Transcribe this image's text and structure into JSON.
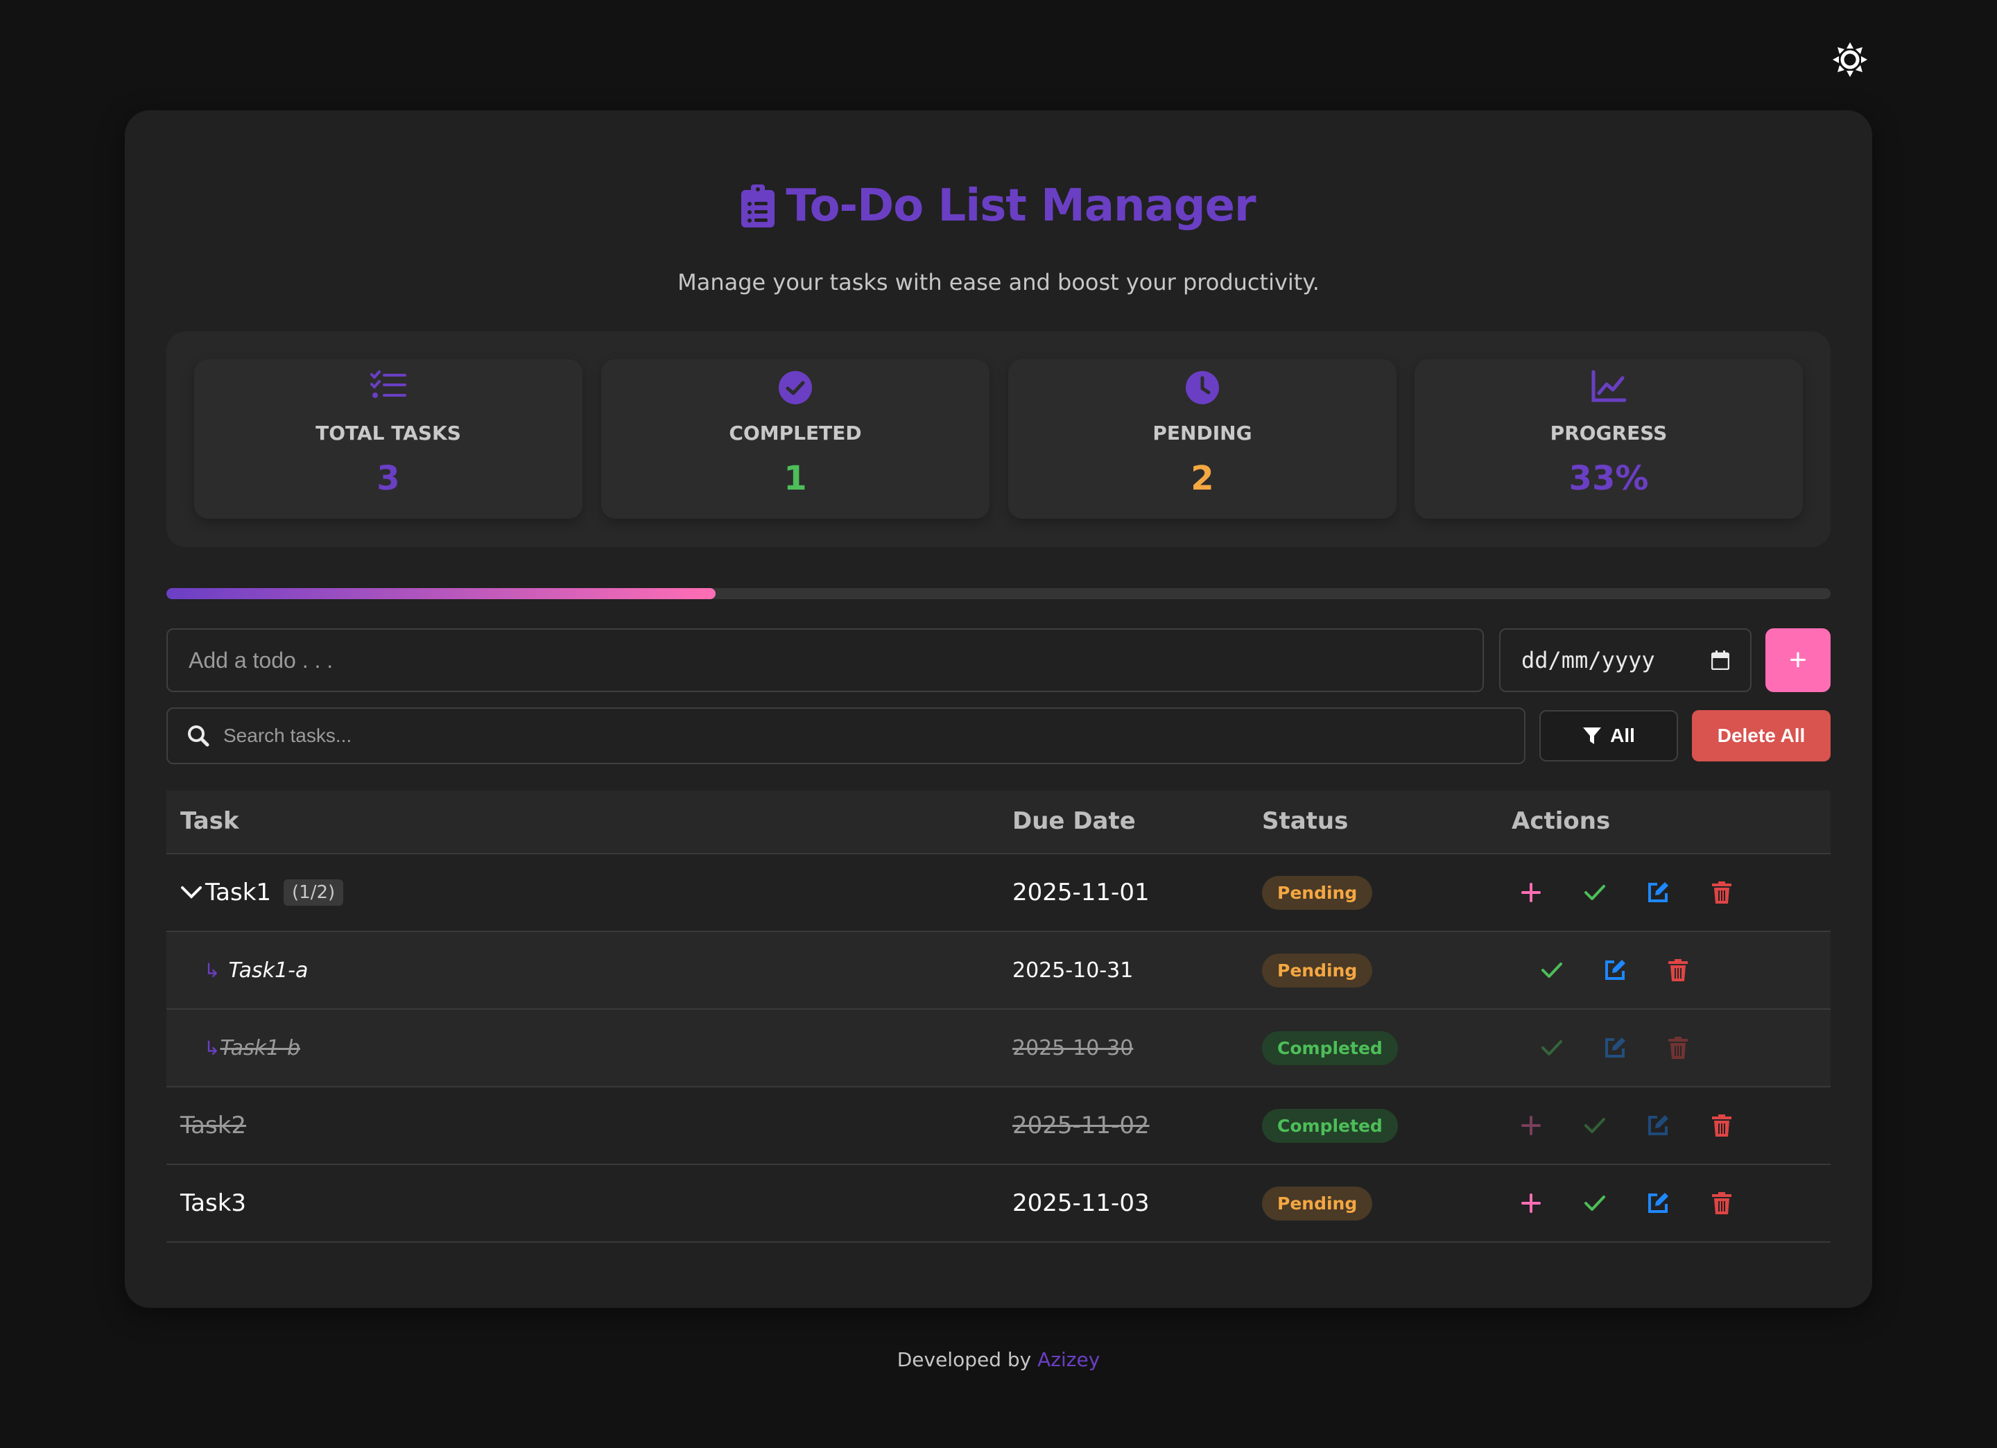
{
  "header": {
    "title": "To-Do List Manager",
    "subtitle": "Manage your tasks with ease and boost your productivity."
  },
  "theme_toggle": {
    "icon": "sun-icon"
  },
  "stats": [
    {
      "label": "TOTAL TASKS",
      "value": "3",
      "icon": "task-list-icon",
      "color": "#6a3fc4"
    },
    {
      "label": "COMPLETED",
      "value": "1",
      "icon": "check-circle-icon",
      "color": "#4dbe59"
    },
    {
      "label": "PENDING",
      "value": "2",
      "icon": "clock-icon",
      "color": "#f5a742"
    },
    {
      "label": "PROGRESS",
      "value": "33%",
      "icon": "chart-line-icon",
      "color": "#6a3fc4"
    }
  ],
  "progress": {
    "percent": 33
  },
  "add_form": {
    "todo_placeholder": "Add a todo . . .",
    "date_placeholder": "dd/mm/yyyy",
    "add_label": "+"
  },
  "search": {
    "placeholder": "Search tasks..."
  },
  "filter": {
    "label": "All"
  },
  "delete_all": {
    "label": "Delete All"
  },
  "table": {
    "headers": {
      "task": "Task",
      "due": "Due Date",
      "status": "Status",
      "actions": "Actions"
    },
    "rows": [
      {
        "name": "Task1",
        "count": "(1/2)",
        "due": "2025-11-01",
        "status": "Pending",
        "level": 0,
        "completed": false
      },
      {
        "name": "Task1-a",
        "due": "2025-10-31",
        "status": "Pending",
        "level": 1,
        "completed": false
      },
      {
        "name": "Task1-b",
        "due": "2025-10-30",
        "status": "Completed",
        "level": 1,
        "completed": true
      },
      {
        "name": "Task2",
        "due": "2025-11-02",
        "status": "Completed",
        "level": 0,
        "completed": true
      },
      {
        "name": "Task3",
        "due": "2025-11-03",
        "status": "Pending",
        "level": 0,
        "completed": false
      }
    ]
  },
  "footer": {
    "prefix": "Developed by",
    "author": "Azizey"
  },
  "colors": {
    "accent": "#6a3fc4",
    "pink": "#ff6eb4",
    "green": "#4dbe59",
    "orange": "#f5a742",
    "blue": "#1e88ff",
    "red": "#e04545"
  }
}
